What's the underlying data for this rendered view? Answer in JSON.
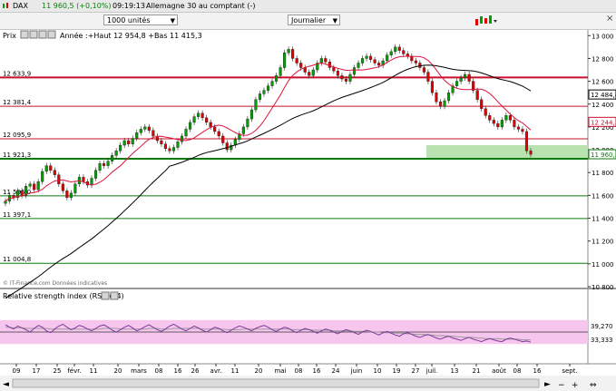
{
  "window": {
    "title": "DAX",
    "last_change": "11 960,5 (+0,10%)",
    "time": "09:19:13",
    "market": "Allemagne 30 au comptant (-)"
  },
  "toolbar": {
    "quantity": "1000 unités",
    "period": "Journalier"
  },
  "panel": {
    "title": "Prix",
    "stats": "Année :+Haut 12 954,8 +Bas 11 415,3",
    "watermark": "© IT-Finance.com Données indicatives"
  },
  "rsi_panel": {
    "title": "Relative strength index (RSI) (14)",
    "value_a": "39,270",
    "value_b": "33,333"
  },
  "colors": {
    "candle_up": "#00a000",
    "candle_down": "#e00000",
    "ma_short": "#dc143c",
    "ma_long": "#000000",
    "support_line": "#0f7a0f",
    "resistance_line": "#c8102e",
    "zone": "#b9e2b1",
    "rsi_band": "#f7c6ef",
    "rsi_line": "#7b3a96",
    "rsi_signal": "#9a9a9a"
  },
  "icons": [
    "settings-icon",
    "close-icon",
    "zoom-icon",
    "pin-icon",
    "candles-icon"
  ],
  "chart_data": [
    {
      "type": "line",
      "title": "",
      "ylim": [
        10800,
        13050
      ],
      "y_ticks": [
        "13 000",
        "12 800",
        "12 600",
        "12 400",
        "12 200",
        "12 000",
        "11 800",
        "11 600",
        "11 400",
        "11 200",
        "11 000",
        "10 800"
      ],
      "x_ticks": [
        "09",
        "17",
        "25",
        "févr.",
        "11",
        "20",
        "mars",
        "08",
        "16",
        "26",
        "avr.",
        "11",
        "20",
        "mai",
        "08",
        "16",
        "24",
        "juin",
        "10",
        "19",
        "27",
        "juil.",
        "13",
        "21",
        "août",
        "08",
        "16",
        "sept."
      ],
      "horizontal_levels": [
        {
          "label": "12 633,9",
          "value": 12633.9,
          "kind": "resistance"
        },
        {
          "label": "12 381,4",
          "value": 12381.4,
          "kind": "resistance"
        },
        {
          "label": "12 095,9",
          "value": 12095.9,
          "kind": "resistance"
        },
        {
          "label": "11 921,3",
          "value": 11921.3,
          "kind": "support"
        },
        {
          "label": "11 596,0",
          "value": 11596.0,
          "kind": "support"
        },
        {
          "label": "11 397,1",
          "value": 11397.1,
          "kind": "support"
        },
        {
          "label": "11 004,8",
          "value": 11004.8,
          "kind": "support"
        }
      ],
      "right_labels": [
        {
          "label": "12 484,4",
          "value": 12484.4
        },
        {
          "label": "12 244,3",
          "value": 12244.3
        },
        {
          "label": "11 960,5",
          "value": 11960.5
        }
      ],
      "zone": {
        "from": 11921.3,
        "to": 12040
      },
      "close_series": [
        11550,
        11600,
        11580,
        11640,
        11600,
        11680,
        11700,
        11650,
        11720,
        11810,
        11860,
        11820,
        11780,
        11700,
        11640,
        11580,
        11620,
        11700,
        11760,
        11720,
        11690,
        11750,
        11820,
        11880,
        11860,
        11900,
        11950,
        11990,
        12040,
        12080,
        12050,
        12100,
        12150,
        12180,
        12200,
        12170,
        12120,
        12080,
        12050,
        12010,
        11990,
        12020,
        12070,
        12120,
        12180,
        12240,
        12290,
        12320,
        12280,
        12240,
        12200,
        12160,
        12120,
        12060,
        12000,
        12040,
        12090,
        12140,
        12200,
        12270,
        12350,
        12440,
        12490,
        12520,
        12560,
        12600,
        12650,
        12720,
        12850,
        12880,
        12800,
        12760,
        12720,
        12680,
        12650,
        12700,
        12760,
        12800,
        12770,
        12720,
        12690,
        12650,
        12620,
        12600,
        12660,
        12720,
        12760,
        12800,
        12820,
        12790,
        12760,
        12740,
        12780,
        12830,
        12860,
        12900,
        12870,
        12840,
        12820,
        12780,
        12760,
        12720,
        12680,
        12600,
        12500,
        12420,
        12380,
        12430,
        12500,
        12560,
        12600,
        12630,
        12660,
        12600,
        12520,
        12440,
        12360,
        12300,
        12260,
        12230,
        12200,
        12260,
        12300,
        12260,
        12200,
        12180,
        12160,
        11990,
        11960
      ],
      "rsi": {
        "ylim": [
          0,
          100
        ],
        "values": [
          62,
          58,
          55,
          60,
          57,
          54,
          50,
          56,
          61,
          58,
          52,
          49,
          55,
          60,
          63,
          58,
          54,
          57,
          61,
          59,
          55,
          52,
          56,
          60,
          62,
          58,
          53,
          50,
          54,
          58,
          61,
          57,
          52,
          55,
          59,
          62,
          58,
          54,
          51,
          55,
          60,
          63,
          59,
          55,
          52,
          56,
          60,
          57,
          53,
          50,
          54,
          58,
          56,
          52,
          49,
          53,
          57,
          60,
          58,
          55,
          52,
          56,
          59,
          61,
          58,
          54,
          51,
          55,
          58,
          56,
          52,
          49,
          53,
          56,
          54,
          51,
          48,
          52,
          55,
          53,
          50,
          47,
          51,
          54,
          52,
          49,
          46,
          50,
          53,
          51,
          48,
          45,
          49,
          51,
          48,
          45,
          43,
          47,
          49,
          46,
          43,
          41,
          44,
          46,
          43,
          40,
          38,
          41,
          43,
          40,
          38,
          36,
          39,
          41,
          38,
          36,
          34,
          37,
          39,
          37,
          35,
          34,
          38,
          40,
          38,
          36,
          34,
          35,
          33
        ],
        "signal": [
          58,
          58,
          57,
          57,
          57,
          56,
          56,
          56,
          56,
          56,
          56,
          55,
          55,
          55,
          55,
          55,
          55,
          55,
          55,
          55,
          55,
          55,
          55,
          55,
          56,
          56,
          56,
          56,
          55,
          55,
          55,
          55,
          55,
          55,
          55,
          56,
          56,
          56,
          55,
          55,
          55,
          56,
          56,
          56,
          56,
          56,
          56,
          56,
          55,
          55,
          55,
          55,
          55,
          55,
          54,
          54,
          54,
          54,
          55,
          55,
          55,
          55,
          55,
          55,
          55,
          55,
          55,
          55,
          55,
          55,
          54,
          54,
          54,
          54,
          54,
          53,
          53,
          53,
          53,
          53,
          52,
          52,
          52,
          52,
          52,
          51,
          51,
          51,
          51,
          50,
          50,
          50,
          49,
          49,
          49,
          48,
          48,
          48,
          47,
          47,
          46,
          46,
          46,
          45,
          45,
          44,
          44,
          44,
          43,
          43,
          42,
          42,
          41,
          41,
          41,
          40,
          40,
          39,
          39,
          39,
          39,
          38,
          38,
          38,
          38,
          38,
          37,
          37,
          37
        ],
        "band": [
          30,
          70
        ],
        "line_levels": [
          50
        ]
      }
    }
  ]
}
